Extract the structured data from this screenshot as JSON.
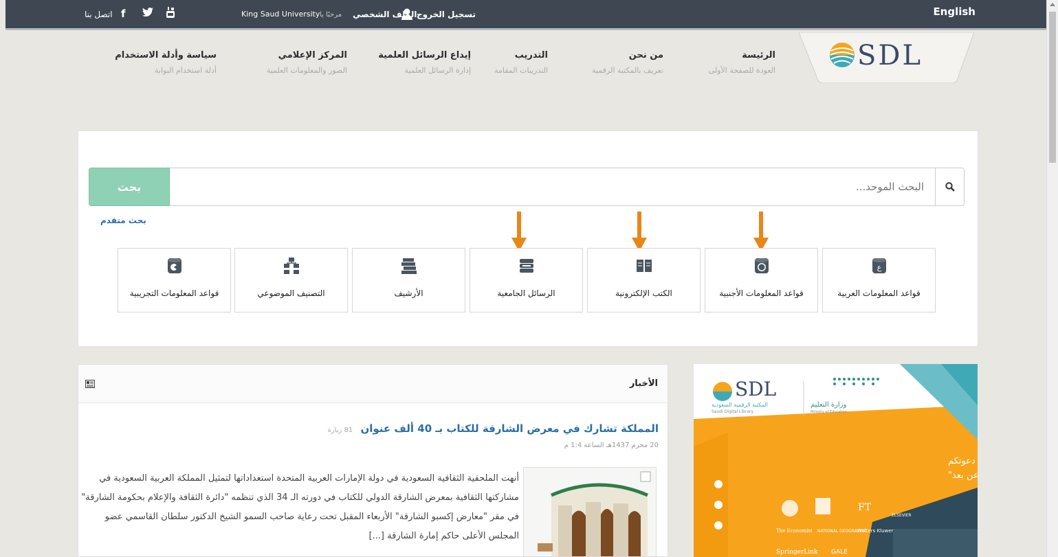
{
  "topbar": {
    "english": "English",
    "contact": "اتصل بنا",
    "facebook": "f",
    "university": "King Saud University",
    "welcome": "مرحبًا يا",
    "profile": "الملف الشخصي",
    "logout": "تسجيل الخروج"
  },
  "logo": {
    "text": "SDL"
  },
  "nav": [
    {
      "title": "الرئيسة",
      "sub": "العودة للصفحة الأولى"
    },
    {
      "title": "من نحن",
      "sub": "تعريف بالمكتبة الرقمية"
    },
    {
      "title": "التدريب",
      "sub": "التدريبات المقامة"
    },
    {
      "title": "إيداع الرسائل العلمية",
      "sub": "إدارة الرسائل العلمية"
    },
    {
      "title": "المركز الإعلامي",
      "sub": "الصور والمعلومات العلمية"
    },
    {
      "title": "سياسة وأدلة الاستخدام",
      "sub": "أدلة استخدام البوابة"
    }
  ],
  "search": {
    "button": "بحث",
    "placeholder": "البحث الموحد...",
    "advanced": "بحث متقدم"
  },
  "tiles": [
    {
      "label": "قواعد المعلومات العربية",
      "icon": "arabic-db-icon"
    },
    {
      "label": "قواعد المعلومات الأجنبية",
      "icon": "foreign-db-icon"
    },
    {
      "label": "الكتب الإلكترونية",
      "icon": "ebook-icon"
    },
    {
      "label": "الرسائل الجامعية",
      "icon": "thesis-icon"
    },
    {
      "label": "الأرشيف",
      "icon": "archive-icon"
    },
    {
      "label": "التصنيف الموضوعي",
      "icon": "classification-icon"
    },
    {
      "label": "قواعد المعلومات التجريبية",
      "icon": "trial-db-icon"
    }
  ],
  "news": {
    "title": "الأخبار",
    "article": {
      "headline": "المملكة تشارك في معرض الشارقة للكتاب بـ 40 ألف عنوان",
      "views": "81 زيارة",
      "date": "20 محرم 1437هـ الساعة 1:4 م",
      "body": "أنهت الملحقية الثقافية السعودية في دولة الإمارات العربية المتحدة استعداداتها لتمثيل المملكة العربية السعودية في مشاركتها الثقافية بمعرض الشارقة الدولي للكتاب في دورته الـ 34 الذي تنظمه \"دائرة الثقافة والإعلام بحكومة الشارقة\" في مقر \"معارض إكسبو الشارقة\" الأربعاء المقبل تحت رعاية صاحب السمو الشيخ الدكتور سلطان القاسمي عضو المجلس الأعلى حاكم إمارة الشارقة [...]"
    }
  },
  "promo": {
    "logo": "SDL",
    "library_name": "المكتبة الرقمية السعودية",
    "library_name_en": "Saudi Digital Library",
    "ministry": "وزارة التعليم",
    "ministry_en": "Ministry of Education",
    "line1": "يسر المكتبة الرقمية السعودية دعوتكم",
    "line2": "للتسجيل في الدورات الإلكترونية \"عن بعد\"",
    "partners": [
      "FT",
      "ELSEVIER",
      "The Economist",
      "NATIONAL GEOGRAPHIC",
      "Wolters Kluwer",
      "SpringerLink",
      "GALE"
    ]
  },
  "colors": {
    "topbar": "#3f4852",
    "search_button": "#8fd1b5",
    "arrow": "#e8861a",
    "link": "#2b6ea4",
    "promo_orange": "#f7a41c",
    "promo_teal": "#3fa9b5"
  }
}
